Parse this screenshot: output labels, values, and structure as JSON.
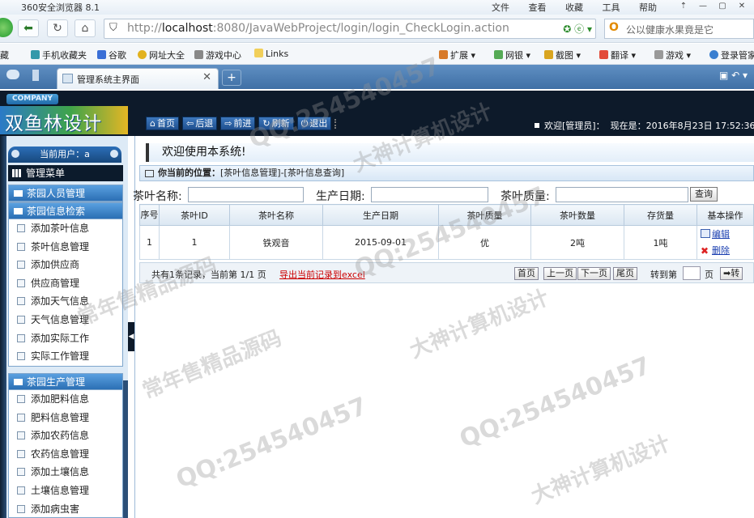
{
  "browser": {
    "app_name": "360安全浏览器 8.1",
    "menus": [
      "文件",
      "查看",
      "收藏",
      "工具",
      "帮助"
    ],
    "url_host": "localhost",
    "url_rest": ":8080/JavaWebProject/login/login_CheckLogin.action",
    "search_placeholder": "公以健康水果竟是它",
    "bookmarks": [
      "藏",
      "手机收藏夹",
      "谷歌",
      "网址大全",
      "游戏中心",
      "Links",
      "扩展",
      "网银",
      "截图",
      "翻译",
      "游戏",
      "登录管家"
    ],
    "tab_title": "管理系统主界面"
  },
  "header": {
    "company": "COMPANY",
    "brand": "双鱼林设计",
    "nav": [
      {
        "icon": "home-icon",
        "glyph": "⌂",
        "label": "首页"
      },
      {
        "icon": "back-icon",
        "glyph": "⇦",
        "label": "后退"
      },
      {
        "icon": "forward-icon",
        "glyph": "⇨",
        "label": "前进"
      },
      {
        "icon": "refresh-icon",
        "glyph": "↻",
        "label": "刷新"
      },
      {
        "icon": "power-icon",
        "glyph": "⏻",
        "label": "退出"
      }
    ],
    "welcome": "欢迎[管理员]：",
    "now_label": "现在是：2016年8月23日 17:52:36"
  },
  "sidebar": {
    "current_user": "当前用户：a",
    "menu_title": "管理菜单",
    "groups": [
      {
        "title": "茶园人员管理",
        "items": []
      },
      {
        "title": "茶园信息检索",
        "items": [
          "添加茶叶信息",
          "茶叶信息管理",
          "添加供应商",
          "供应商管理",
          "添加天气信息",
          "天气信息管理",
          "添加实际工作",
          "实际工作管理"
        ]
      },
      {
        "title": "茶园生产管理",
        "items": [
          "添加肥料信息",
          "肥料信息管理",
          "添加农药信息",
          "农药信息管理",
          "添加土壤信息",
          "土壤信息管理",
          "添加病虫害"
        ]
      }
    ]
  },
  "main": {
    "welcome": "欢迎使用本系统!",
    "location_label": "你当前的位置：",
    "location_path": "[茶叶信息管理]-[茶叶信息查询]",
    "filters": {
      "name_label": "茶叶名称:",
      "date_label": "生产日期:",
      "quality_label": "茶叶质量:",
      "query_button": "查询"
    },
    "table": {
      "columns": [
        "序号",
        "茶叶ID",
        "茶叶名称",
        "生产日期",
        "茶叶质量",
        "茶叶数量",
        "存货量",
        "基本操作"
      ],
      "rows": [
        {
          "seq": "1",
          "id": "1",
          "name": "铁观音",
          "date": "2015-09-01",
          "quality": "优",
          "qty": "2吨",
          "stock": "1吨"
        }
      ],
      "edit_label": "编辑",
      "delete_label": "删除"
    },
    "pager": {
      "info": "共有1条记录，当前第 1/1 页",
      "export": "导出当前记录到excel",
      "first": "首页",
      "prev": "上一页",
      "next": "下一页",
      "last": "尾页",
      "goto": "转到第",
      "page": "页",
      "go": "➡转"
    }
  },
  "watermarks": [
    "QQ:254540457",
    "大神计算机设计",
    "常年售精品源码"
  ]
}
